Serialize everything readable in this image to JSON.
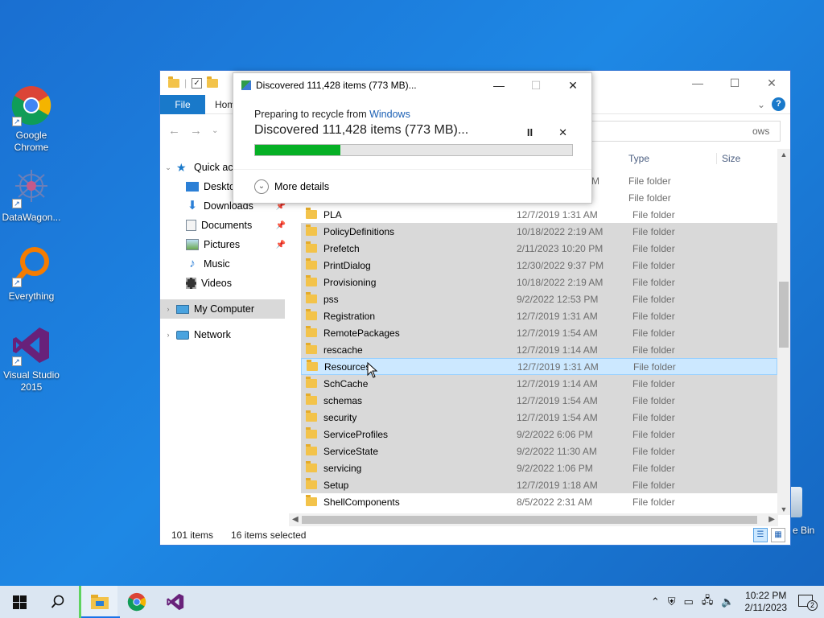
{
  "desktop": {
    "icons": [
      {
        "label": "Google Chrome"
      },
      {
        "label": "DataWagon..."
      },
      {
        "label": "Everything"
      },
      {
        "label": "Visual Studio 2015"
      }
    ],
    "recycle_bin_label": "e Bin"
  },
  "explorer": {
    "ribbon": {
      "file_tab": "File",
      "home_tab": "Hom"
    },
    "search_placeholder": "ows",
    "nav": {
      "quick_access": "Quick ac",
      "desktop": "Deskto",
      "downloads": "Downloads",
      "documents": "Documents",
      "pictures": "Pictures",
      "music": "Music",
      "videos": "Videos",
      "my_computer": "My Computer",
      "network": "Network"
    },
    "columns": {
      "type": "Type",
      "size": "Size"
    },
    "partial_rows": [
      {
        "date_tail": "M",
        "type": "File folder"
      },
      {
        "date_tail": "",
        "type": "File folder"
      }
    ],
    "rows": [
      {
        "name": "PLA",
        "date": "12/7/2019 1:31 AM",
        "type": "File folder",
        "state": "normal"
      },
      {
        "name": "PolicyDefinitions",
        "date": "10/18/2022 2:19 AM",
        "type": "File folder",
        "state": "sel"
      },
      {
        "name": "Prefetch",
        "date": "2/11/2023 10:20 PM",
        "type": "File folder",
        "state": "sel"
      },
      {
        "name": "PrintDialog",
        "date": "12/30/2022 9:37 PM",
        "type": "File folder",
        "state": "sel"
      },
      {
        "name": "Provisioning",
        "date": "10/18/2022 2:19 AM",
        "type": "File folder",
        "state": "sel"
      },
      {
        "name": "pss",
        "date": "9/2/2022 12:53 PM",
        "type": "File folder",
        "state": "sel"
      },
      {
        "name": "Registration",
        "date": "12/7/2019 1:31 AM",
        "type": "File folder",
        "state": "sel"
      },
      {
        "name": "RemotePackages",
        "date": "12/7/2019 1:54 AM",
        "type": "File folder",
        "state": "sel"
      },
      {
        "name": "rescache",
        "date": "12/7/2019 1:14 AM",
        "type": "File folder",
        "state": "sel"
      },
      {
        "name": "Resources",
        "date": "12/7/2019 1:31 AM",
        "type": "File folder",
        "state": "hot"
      },
      {
        "name": "SchCache",
        "date": "12/7/2019 1:14 AM",
        "type": "File folder",
        "state": "sel"
      },
      {
        "name": "schemas",
        "date": "12/7/2019 1:54 AM",
        "type": "File folder",
        "state": "sel"
      },
      {
        "name": "security",
        "date": "12/7/2019 1:54 AM",
        "type": "File folder",
        "state": "sel"
      },
      {
        "name": "ServiceProfiles",
        "date": "9/2/2022 6:06 PM",
        "type": "File folder",
        "state": "sel"
      },
      {
        "name": "ServiceState",
        "date": "9/2/2022 11:30 AM",
        "type": "File folder",
        "state": "sel"
      },
      {
        "name": "servicing",
        "date": "9/2/2022 1:06 PM",
        "type": "File folder",
        "state": "sel"
      },
      {
        "name": "Setup",
        "date": "12/7/2019 1:18 AM",
        "type": "File folder",
        "state": "sel"
      },
      {
        "name": "ShellComponents",
        "date": "8/5/2022 2:31 AM",
        "type": "File folder",
        "state": "normal"
      }
    ],
    "status": {
      "item_count": "101 items",
      "selected": "16 items selected"
    }
  },
  "dialog": {
    "title": "Discovered 111,428 items (773 MB)...",
    "preparing": "Preparing to recycle from ",
    "source": "Windows",
    "headline": "Discovered 111,428 items (773 MB)...",
    "progress_fraction": 0.27,
    "more_details": "More details",
    "pause_glyph": "II",
    "cancel_glyph": "✕"
  },
  "taskbar": {
    "time": "10:22 PM",
    "date": "2/11/2023",
    "notification_count": "2"
  },
  "colors": {
    "accent": "#1979ca",
    "progress": "#06b025",
    "selection": "#d9d9d9",
    "hover": "#cce8ff"
  }
}
